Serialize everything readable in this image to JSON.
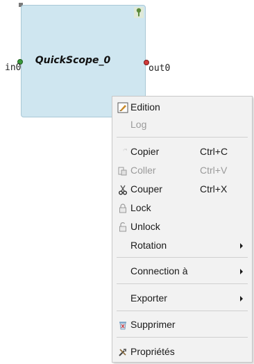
{
  "block": {
    "title": "QuickScope_0",
    "input_port": "in0",
    "output_port": "out0",
    "fill_color": "#cfe6f0",
    "pin_icon": "pin-icon"
  },
  "context_menu": {
    "items": [
      {
        "label": "Edition",
        "icon": "edit-icon",
        "enabled": true
      },
      {
        "label": "Log",
        "enabled": false
      },
      {
        "label": "Copier",
        "shortcut": "Ctrl+C",
        "icon": "copy-icon",
        "enabled": true
      },
      {
        "label": "Coller",
        "shortcut": "Ctrl+V",
        "icon": "paste-icon",
        "enabled": false
      },
      {
        "label": "Couper",
        "shortcut": "Ctrl+X",
        "icon": "cut-icon",
        "enabled": true
      },
      {
        "label": "Lock",
        "icon": "lock-icon",
        "enabled": true
      },
      {
        "label": "Unlock",
        "icon": "unlock-icon",
        "enabled": true
      },
      {
        "label": "Rotation",
        "submenu": true,
        "enabled": true
      },
      {
        "label": "Connection à",
        "submenu": true,
        "enabled": true
      },
      {
        "label": "Exporter",
        "submenu": true,
        "enabled": true
      },
      {
        "label": "Supprimer",
        "icon": "delete-icon",
        "enabled": true
      },
      {
        "label": "Propriétés",
        "icon": "properties-icon",
        "enabled": true
      }
    ]
  }
}
